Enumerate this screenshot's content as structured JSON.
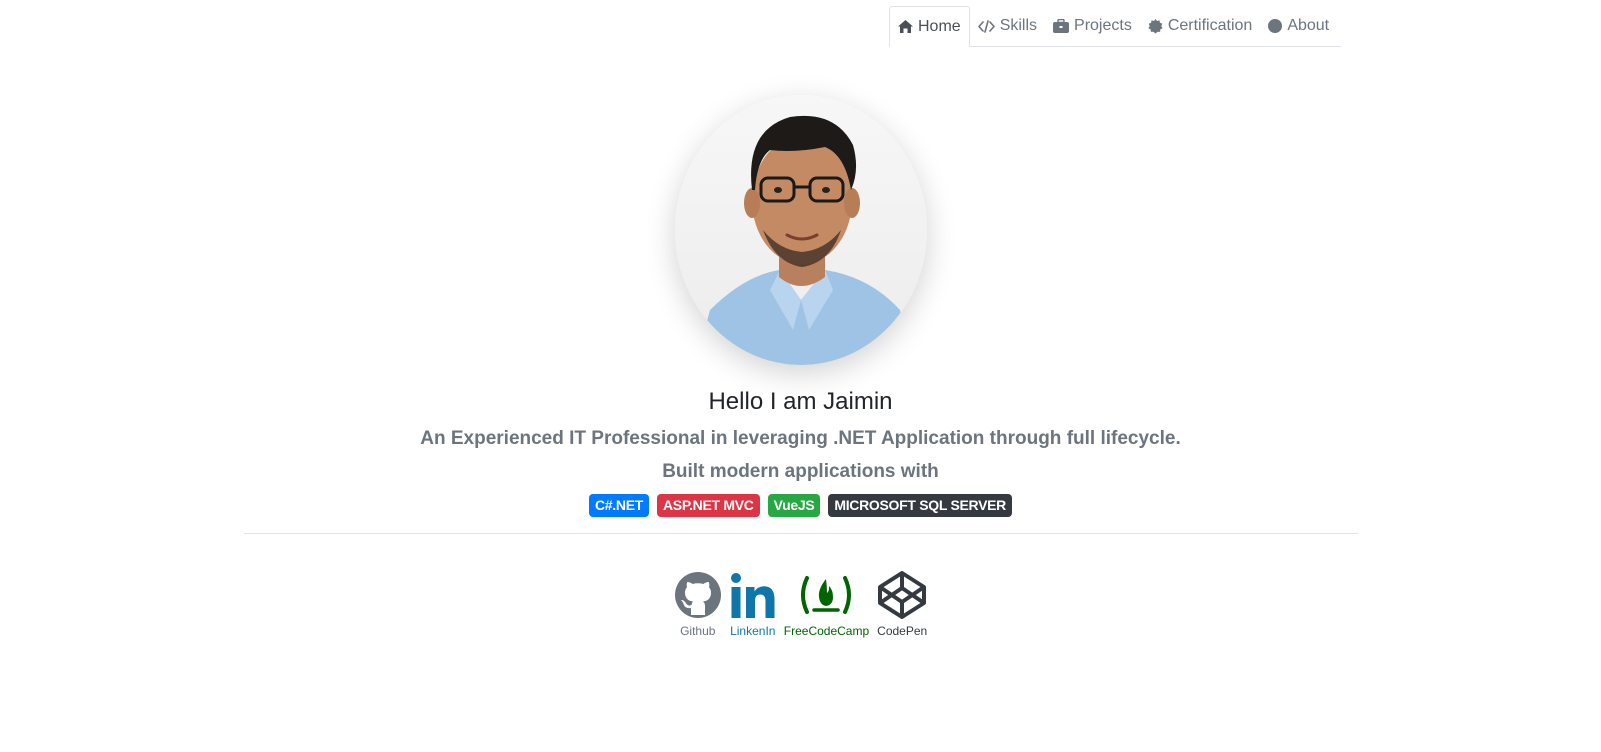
{
  "nav": {
    "items": [
      {
        "label": "Home",
        "icon": "home-icon",
        "active": true
      },
      {
        "label": "Skills",
        "icon": "code-icon",
        "active": false
      },
      {
        "label": "Projects",
        "icon": "briefcase-icon",
        "active": false
      },
      {
        "label": "Certification",
        "icon": "certificate-icon",
        "active": false
      },
      {
        "label": "About",
        "icon": "circle-icon",
        "active": false
      }
    ]
  },
  "profile": {
    "greeting": "Hello I am Jaimin",
    "tagline": "An Experienced IT Professional in leveraging .NET Application through full lifecycle.",
    "built_with": "Built modern applications with"
  },
  "badges": [
    {
      "label": "C#.NET",
      "color": "#007bff"
    },
    {
      "label": "ASP.NET MVC",
      "color": "#dc3545"
    },
    {
      "label": "VueJS",
      "color": "#28a745"
    },
    {
      "label": "MICROSOFT SQL SERVER",
      "color": "#343a40"
    }
  ],
  "social": [
    {
      "label": "Github",
      "icon": "github-icon",
      "color": "#6c757d"
    },
    {
      "label": "LinkenIn",
      "icon": "linkedin-icon",
      "color": "#0e76a8"
    },
    {
      "label": "FreeCodeCamp",
      "icon": "freecodecamp-icon",
      "color": "#006400"
    },
    {
      "label": "CodePen",
      "icon": "codepen-icon",
      "color": "#343a40"
    }
  ],
  "colors": {
    "nav_text": "#6c757d",
    "muted": "#6c757d",
    "divider": "#dee2e6"
  }
}
